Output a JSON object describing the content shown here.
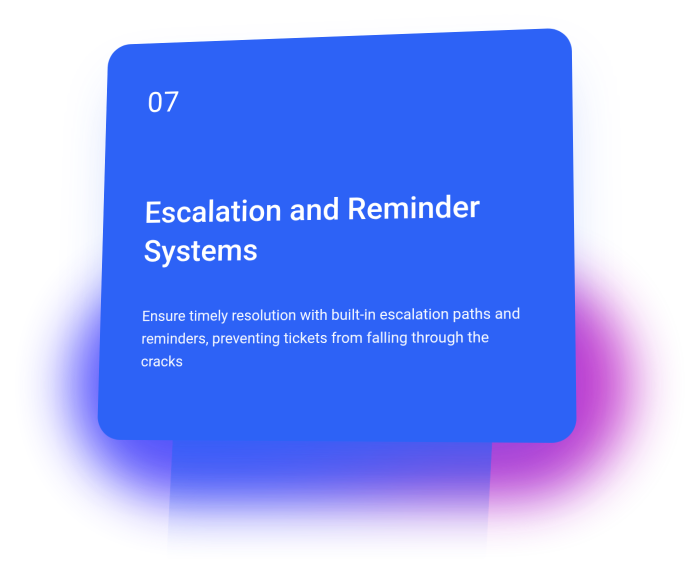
{
  "card": {
    "number": "07",
    "title": "Escalation and Reminder Systems",
    "description": "Ensure timely resolution with built-in escalation paths and reminders, preventing tickets from falling through the cracks"
  },
  "colors": {
    "card_bg": "#2d62f6",
    "glow_blue": "#4b46ff",
    "glow_magenta": "#c828c8",
    "text": "#ffffff"
  }
}
